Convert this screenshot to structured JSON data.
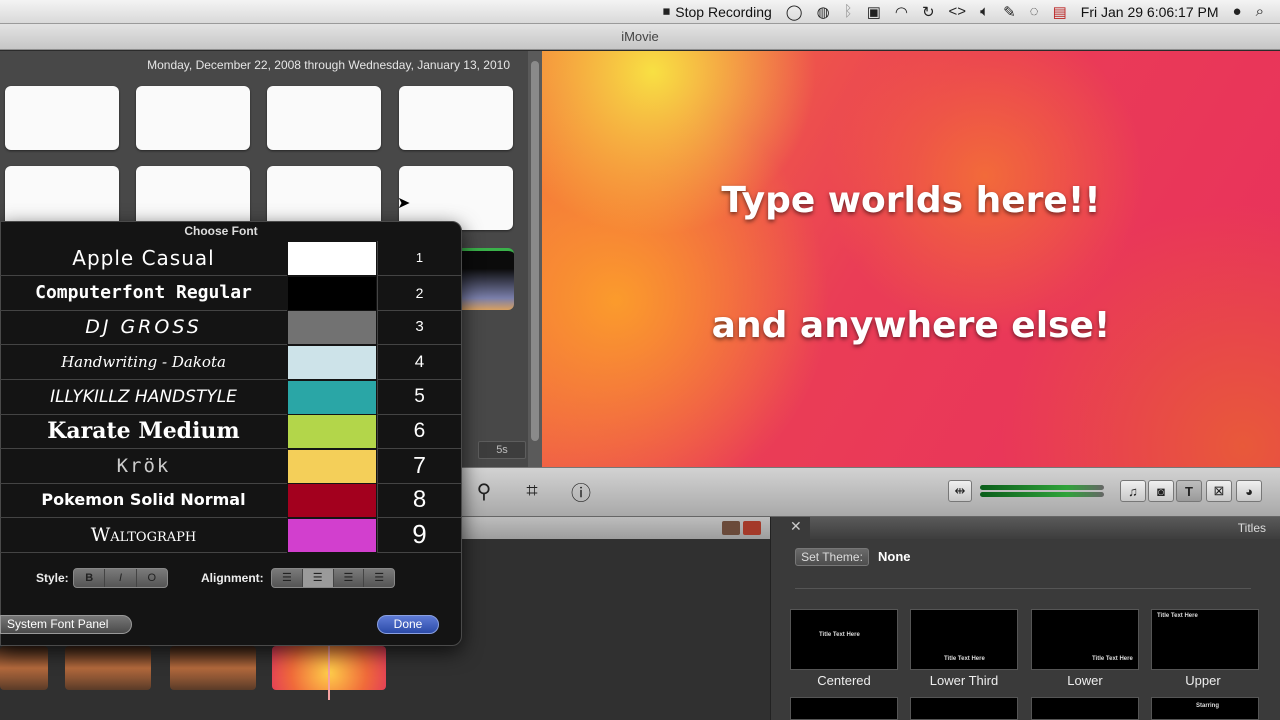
{
  "menubar": {
    "stop_recording": "Stop Recording",
    "datetime": "Fri Jan 29  6:06:17 PM",
    "icons": [
      "record-stop-icon",
      "circle-icon",
      "volume-circle-icon",
      "bluetooth-icon",
      "box-icon",
      "wifi-icon",
      "sync-icon",
      "code-icon",
      "speaker-icon",
      "pen-icon",
      "chat-icon",
      "flag-icon",
      "user-icon",
      "search-icon"
    ]
  },
  "window": {
    "title": "iMovie"
  },
  "browser": {
    "date_range": "Monday, December 22, 2008 through Wednesday, January 13, 2010"
  },
  "viewer": {
    "line1": "Type worlds here!!",
    "line2": "and anywhere else!"
  },
  "project": {
    "timecode": "5s"
  },
  "titles": {
    "panel_label": "Titles",
    "set_theme_label": "Set Theme:",
    "theme_value": "None",
    "cards": [
      {
        "label": "Centered",
        "mini": "Title Text Here"
      },
      {
        "label": "Lower Third",
        "mini": "Title Text Here"
      },
      {
        "label": "Lower",
        "mini": "Title Text Here"
      },
      {
        "label": "Upper",
        "mini": "Title Text Here"
      }
    ],
    "starting_mini": "Starring"
  },
  "font_panel": {
    "title": "Choose Font",
    "fonts": [
      {
        "name": "Apple Casual",
        "color": "#ffffff",
        "num": "1"
      },
      {
        "name": "Computerfont Regular",
        "color": "#000000",
        "num": "2"
      },
      {
        "name": "DJ GROSS",
        "color": "#727272",
        "num": "3"
      },
      {
        "name": "Handwriting - Dakota",
        "color": "#cde3e9",
        "num": "4"
      },
      {
        "name": "ILLYKILLZ HANDSTYLE",
        "color": "#2aa6a6",
        "num": "5"
      },
      {
        "name": "Karate Medium",
        "color": "#b3d64a",
        "num": "6"
      },
      {
        "name": "Krök",
        "color": "#f4cf59",
        "num": "7"
      },
      {
        "name": "Pokemon Solid Normal",
        "color": "#a3001e",
        "num": "8"
      },
      {
        "name": "Waltograph",
        "color": "#d23fce",
        "num": "9"
      }
    ],
    "style_label": "Style:",
    "style_buttons": [
      "B",
      "I",
      "O"
    ],
    "alignment_label": "Alignment:",
    "system_font_panel": "System Font Panel",
    "done": "Done"
  }
}
